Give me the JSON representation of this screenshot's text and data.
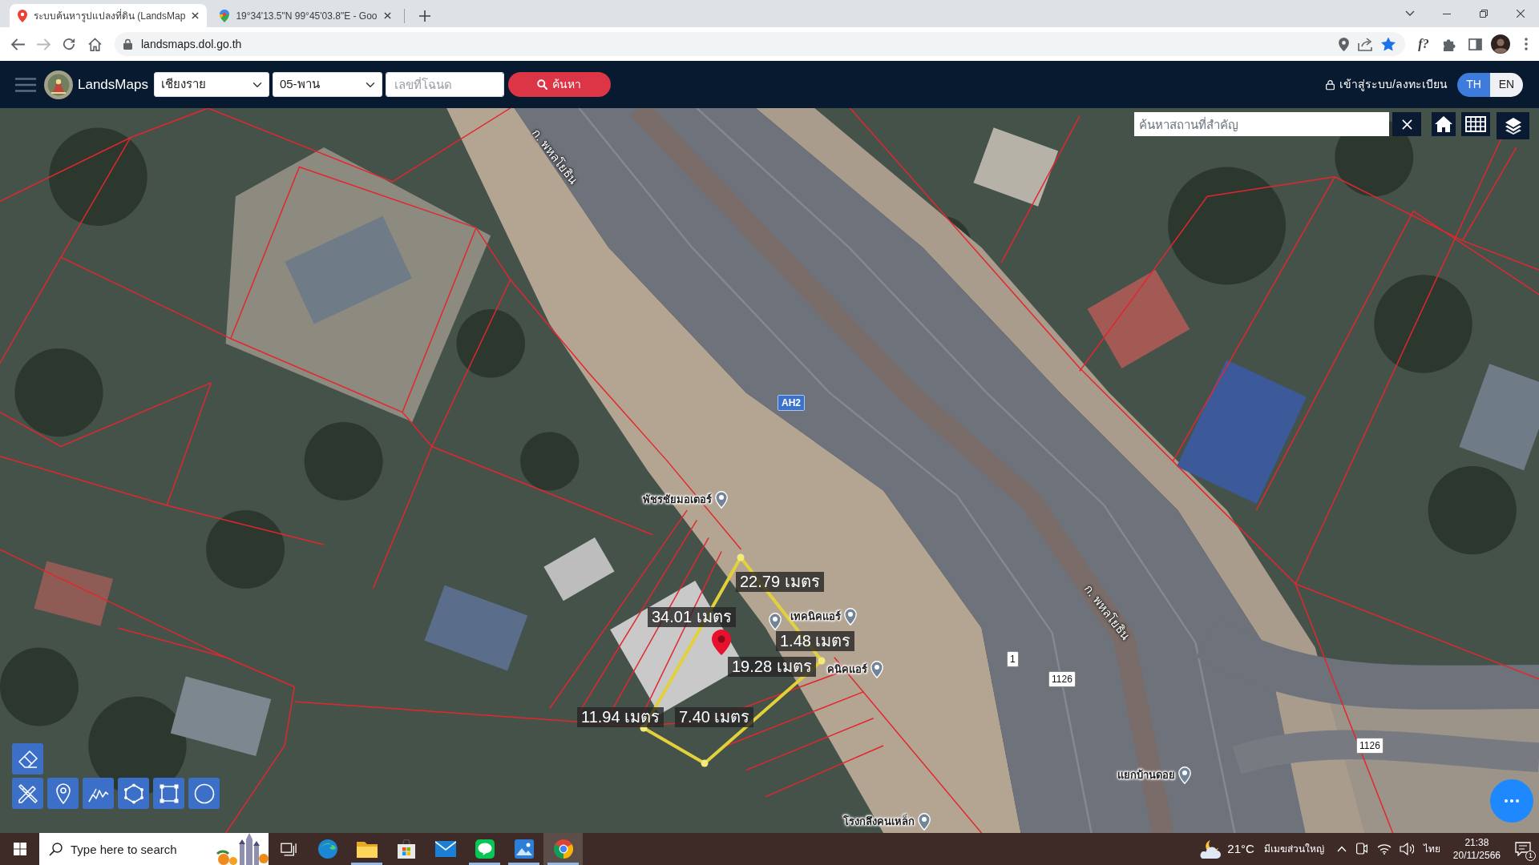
{
  "browser": {
    "tabs": [
      {
        "title": "ระบบค้นหารูปแปลงที่ดิน (LandsMap",
        "selected": true
      },
      {
        "title": "19°34'13.5\"N 99°45'03.8\"E - Goo",
        "selected": false
      }
    ],
    "address": "landsmaps.dol.go.th",
    "bookmarked": true,
    "extension": "f?"
  },
  "navbar": {
    "brand": "LandsMaps",
    "province": "เชียงราย",
    "district": "05-พาน",
    "deed_field": {
      "placeholder": "เลขที่โฉนด"
    },
    "search_button": "ค้นหา",
    "login": "เข้าสู่ระบบ/ลงทะเบียน",
    "languages": [
      {
        "label": "TH",
        "selected": true
      },
      {
        "label": "EN",
        "selected": false
      }
    ]
  },
  "map": {
    "place_search": {
      "placeholder": "ค้นหาสถานที่สำคัญ"
    },
    "road_names": [
      "ก. พหลโยธิน",
      "ก. พหลโยธิน"
    ],
    "road_shields": [
      {
        "kind": "asian_highway",
        "label": "AH2"
      },
      {
        "kind": "route",
        "label": "1"
      },
      {
        "kind": "route",
        "label": "1126"
      },
      {
        "kind": "route",
        "label": "1126"
      }
    ],
    "places": [
      {
        "name": "พัชรชัยมอเตอร์"
      },
      {
        "name": "เทคนิคแอร์"
      },
      {
        "name": "คนิคแอร์"
      },
      {
        "name": "แยกบ้านดอย"
      },
      {
        "name": "โรงกลึงคนเหล็ก"
      }
    ],
    "measurements": [
      "22.79 เมตร",
      "34.01 เมตร",
      "1.48 เมตร",
      "19.28 เมตร",
      "11.94 เมตร",
      "7.40 เมตร"
    ]
  },
  "taskbar": {
    "search": {
      "placeholder": "Type here to search"
    },
    "apps": [
      {
        "kind": "task_view",
        "open": false,
        "selected": false
      },
      {
        "kind": "edge",
        "open": false,
        "selected": false
      },
      {
        "kind": "explorer",
        "open": true,
        "selected": false
      },
      {
        "kind": "store",
        "open": false,
        "selected": false
      },
      {
        "kind": "mail",
        "open": false,
        "selected": false
      },
      {
        "kind": "line",
        "open": true,
        "selected": false
      },
      {
        "kind": "photos",
        "open": true,
        "selected": false
      },
      {
        "kind": "chrome",
        "open": true,
        "selected": true
      }
    ],
    "weather": {
      "temperature": "21°C",
      "condition": "มีเมฆส่วนใหญ่"
    },
    "input_language": "ไทย",
    "time": "21:38",
    "date": "20/11/2566",
    "notification_count": "1"
  }
}
